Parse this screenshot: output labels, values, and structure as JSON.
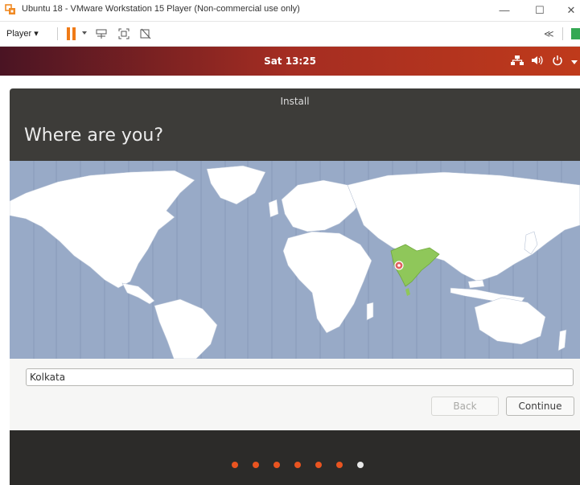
{
  "window": {
    "title": "Ubuntu 18 - VMware Workstation 15 Player (Non-commercial use only)",
    "minimize_glyph": "—",
    "maximize_glyph": "☐",
    "close_glyph": "✕"
  },
  "toolbar": {
    "player_label": "Player ▾",
    "collapse_glyph": "≪"
  },
  "topbar": {
    "clock": "Sat 13:25"
  },
  "installer": {
    "window_title": "Install",
    "heading": "Where are you?",
    "timezone_value": "Kolkata",
    "back_label": "Back",
    "continue_label": "Continue",
    "progress_total": 7,
    "progress_current": 7
  },
  "colors": {
    "accent": "#f07b17",
    "ubuntu_orange": "#e95420",
    "map_water": "#98aac7",
    "selected_region": "#8fc75a"
  },
  "icons": [
    "vmware-logo-icon",
    "pause-icon",
    "send-keys-icon",
    "fullscreen-icon",
    "unity-icon",
    "network-icon",
    "volume-icon",
    "power-icon",
    "location-pin-icon"
  ]
}
